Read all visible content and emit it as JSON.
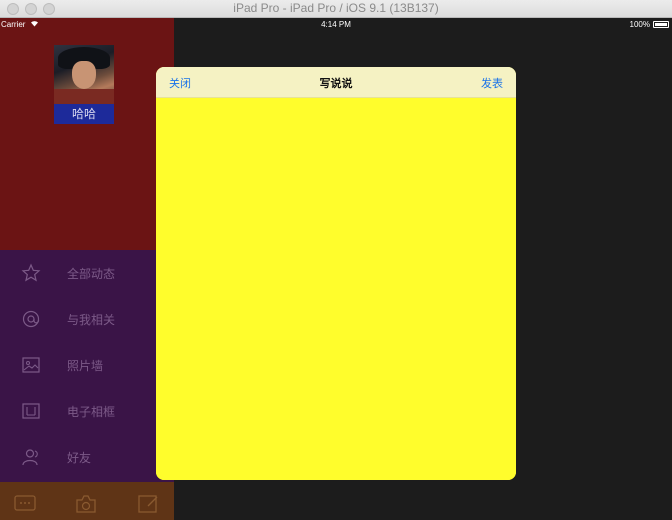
{
  "window": {
    "title": "iPad Pro - iPad Pro / iOS 9.1 (13B137)"
  },
  "statusbar": {
    "carrier": "Carrier",
    "time": "4:14 PM",
    "battery": "100%"
  },
  "profile": {
    "name": "哈哈"
  },
  "menu": {
    "items": [
      {
        "label": "全部动态",
        "icon": "star-icon"
      },
      {
        "label": "与我相关",
        "icon": "at-icon"
      },
      {
        "label": "照片墙",
        "icon": "photo-icon"
      },
      {
        "label": "电子相框",
        "icon": "frame-icon"
      },
      {
        "label": "好友",
        "icon": "friends-icon"
      }
    ]
  },
  "tabbar": {
    "items": [
      {
        "icon": "chat-icon"
      },
      {
        "icon": "camera-icon"
      },
      {
        "icon": "compose-icon"
      }
    ]
  },
  "compose": {
    "close_label": "关闭",
    "title": "写说说",
    "publish_label": "发表",
    "text": ""
  },
  "colors": {
    "profile_bg": "#6b1414",
    "menu_bg": "#3a1447",
    "tabbar_bg": "#5f3416",
    "modal_bg": "#fffd2c",
    "navbar_bg": "#f5f2c3",
    "accent": "#1a73e8"
  }
}
